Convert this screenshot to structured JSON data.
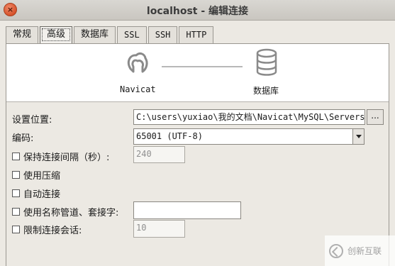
{
  "window": {
    "title": "localhost - 编辑连接",
    "close_glyph": "×"
  },
  "tabs": [
    {
      "label": "常规"
    },
    {
      "label": "高级"
    },
    {
      "label": "数据库"
    },
    {
      "label": "SSL"
    },
    {
      "label": "SSH"
    },
    {
      "label": "HTTP"
    }
  ],
  "active_tab": "高级",
  "diagram": {
    "left_label": "Navicat",
    "right_label": "数据库",
    "left_icon": "navicat-icon",
    "right_icon": "database-icon"
  },
  "settings": {
    "location_label": "设置位置:",
    "location_value": "C:\\users\\yuxiao\\我的文档\\Navicat\\MySQL\\Servers\\localhost",
    "browse_label": "...",
    "encoding_label": "编码:",
    "encoding_value": "65001 (UTF-8)",
    "keepalive_label": "保持连接间隔（秒）:",
    "keepalive_value": "240",
    "compression_label": "使用压缩",
    "autoconnect_label": "自动连接",
    "pipe_label": "使用名称管道、套接字:",
    "pipe_value": "",
    "limit_label": "限制连接会话:",
    "limit_value": "10"
  },
  "watermark": {
    "text": "创新互联"
  },
  "colors": {
    "close_button": "#d6522b",
    "background": "#ece9e3"
  }
}
